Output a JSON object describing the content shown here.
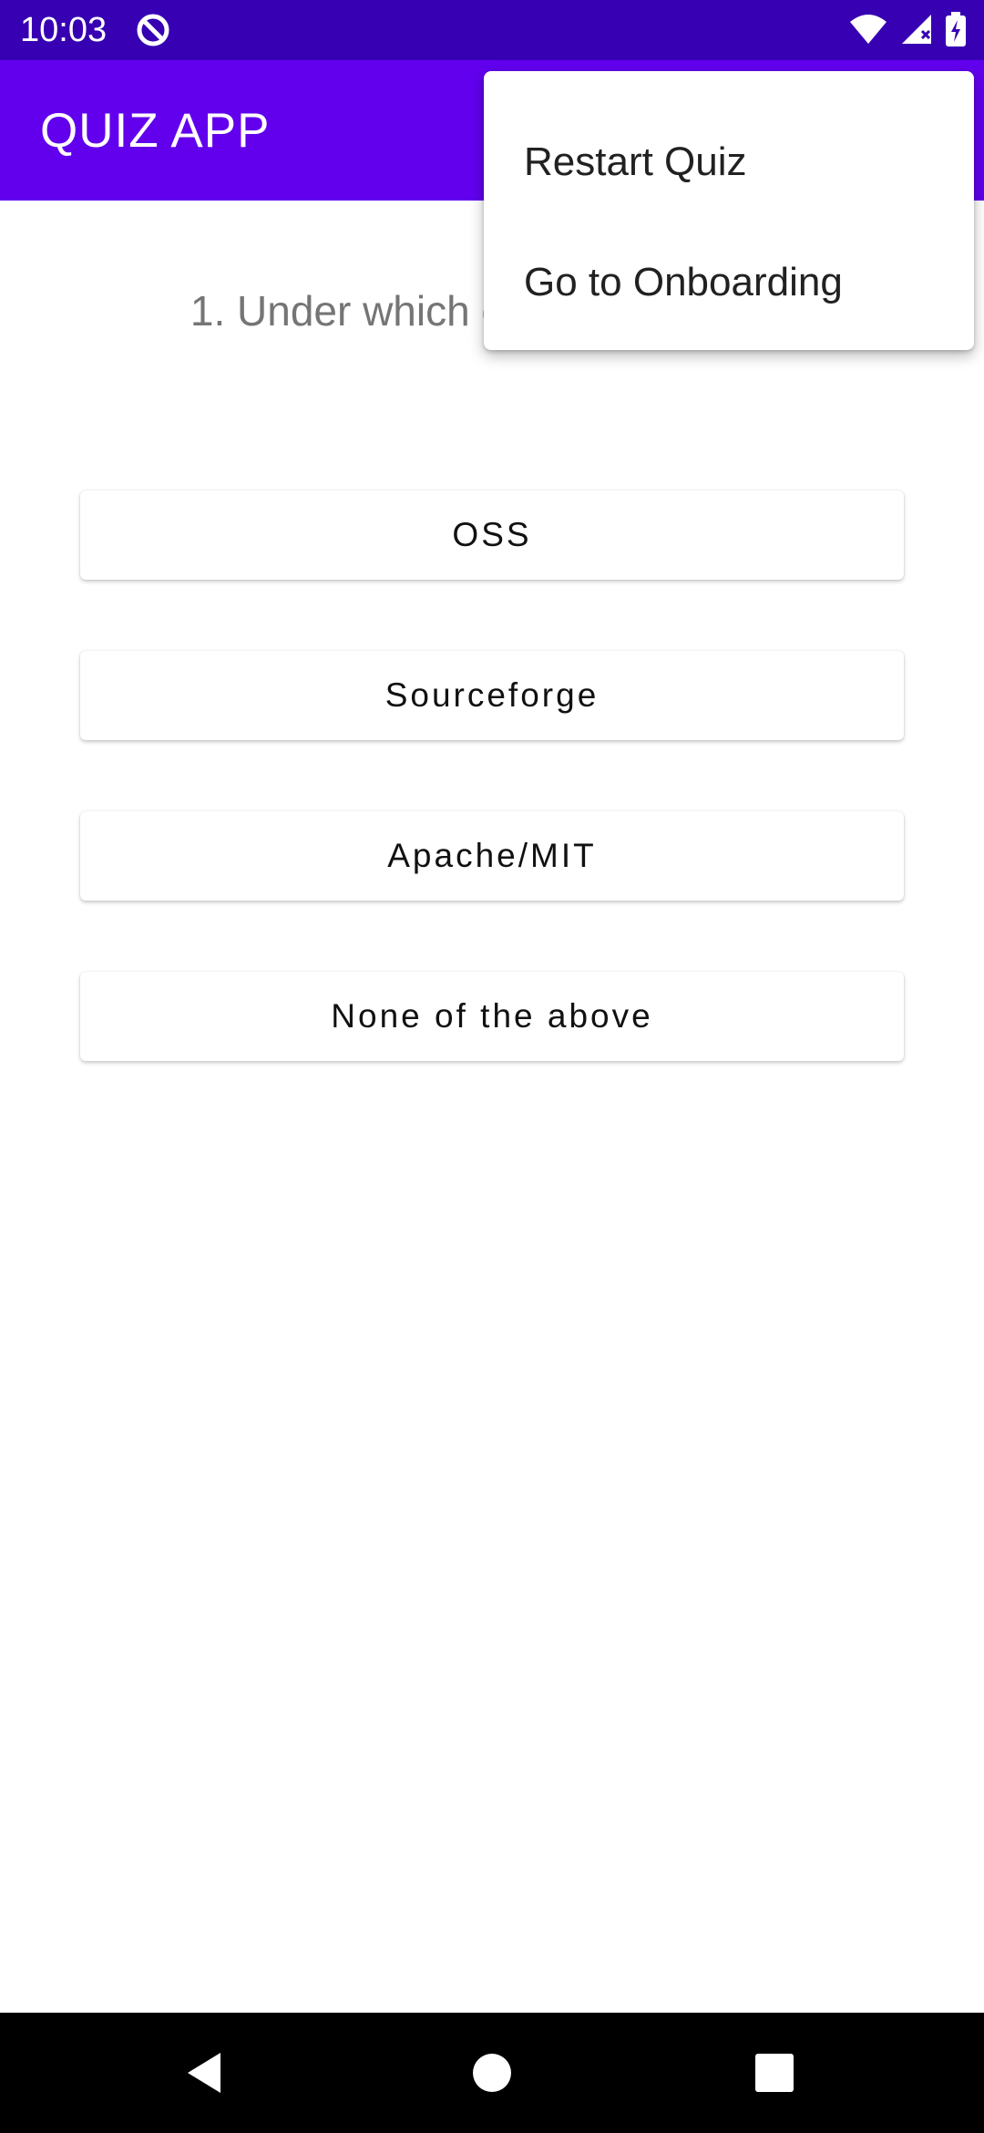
{
  "status_bar": {
    "time": "10:03",
    "icons": [
      "app-notification-icon",
      "wifi-icon",
      "cell-signal-icon",
      "battery-charging-icon"
    ]
  },
  "app_bar": {
    "title": "QUIZ APP",
    "background": "#6200ee"
  },
  "question": {
    "text": "1. Under which of th is licensed?"
  },
  "answers": [
    {
      "label": "OSS"
    },
    {
      "label": "Sourceforge"
    },
    {
      "label": "Apache/MIT"
    },
    {
      "label": "None of the above"
    }
  ],
  "menu": {
    "items": [
      {
        "label": "Restart Quiz"
      },
      {
        "label": "Go to Onboarding"
      }
    ]
  },
  "nav_bar": {
    "icons": [
      "back-icon",
      "home-icon",
      "recents-icon"
    ]
  },
  "colors": {
    "status_bar": "#3700b3",
    "primary": "#6200ee",
    "question_text": "#757575"
  }
}
